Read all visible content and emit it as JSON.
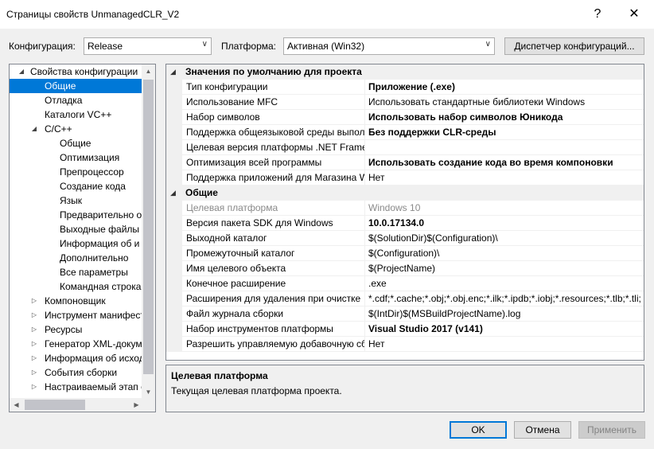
{
  "window": {
    "title": "Страницы свойств UnmanagedCLR_V2",
    "help_glyph": "?",
    "close_glyph": "✕"
  },
  "config_bar": {
    "configuration_label": "Конфигурация:",
    "configuration_value": "Release",
    "platform_label": "Платформа:",
    "platform_value": "Активная (Win32)",
    "manager_button": "Диспетчер конфигураций..."
  },
  "tree": {
    "items": [
      {
        "label": "Свойства конфигурации",
        "toggle": "◢",
        "selected": false
      },
      {
        "label": "Общие",
        "toggle": "",
        "selected": true
      },
      {
        "label": "Отладка",
        "toggle": "",
        "selected": false
      },
      {
        "label": "Каталоги VC++",
        "toggle": "",
        "selected": false
      },
      {
        "label": "C/C++",
        "toggle": "◢",
        "selected": false
      },
      {
        "label": "Общие",
        "toggle": "",
        "selected": false
      },
      {
        "label": "Оптимизация",
        "toggle": "",
        "selected": false
      },
      {
        "label": "Препроцессор",
        "toggle": "",
        "selected": false
      },
      {
        "label": "Создание кода",
        "toggle": "",
        "selected": false
      },
      {
        "label": "Язык",
        "toggle": "",
        "selected": false
      },
      {
        "label": "Предварительно о",
        "toggle": "",
        "selected": false
      },
      {
        "label": "Выходные файлы",
        "toggle": "",
        "selected": false
      },
      {
        "label": "Информация об и",
        "toggle": "",
        "selected": false
      },
      {
        "label": "Дополнительно",
        "toggle": "",
        "selected": false
      },
      {
        "label": "Все параметры",
        "toggle": "",
        "selected": false
      },
      {
        "label": "Командная строка",
        "toggle": "",
        "selected": false
      },
      {
        "label": "Компоновщик",
        "toggle": "▷",
        "selected": false
      },
      {
        "label": "Инструмент манифест",
        "toggle": "▷",
        "selected": false
      },
      {
        "label": "Ресурсы",
        "toggle": "▷",
        "selected": false
      },
      {
        "label": "Генератор XML-докум",
        "toggle": "▷",
        "selected": false
      },
      {
        "label": "Информация об исход",
        "toggle": "▷",
        "selected": false
      },
      {
        "label": "События сборки",
        "toggle": "▷",
        "selected": false
      },
      {
        "label": "Настраиваемый этап с",
        "toggle": "▷",
        "selected": false
      }
    ],
    "scroll_up_glyph": "▲",
    "scroll_down_glyph": "▼",
    "scroll_left_glyph": "◀",
    "scroll_right_glyph": "▶"
  },
  "grid": {
    "rows": [
      {
        "kind": "category",
        "name": "Значения по умолчанию для проекта",
        "toggle": "◢"
      },
      {
        "kind": "prop",
        "name": "Тип конфигурации",
        "value": "Приложение (.exe)",
        "style": "bold"
      },
      {
        "kind": "prop",
        "name": "Использование MFC",
        "value": "Использовать стандартные библиотеки Windows",
        "style": ""
      },
      {
        "kind": "prop",
        "name": "Набор символов",
        "value": "Использовать набор символов Юникода",
        "style": "bold"
      },
      {
        "kind": "prop",
        "name": "Поддержка общеязыковой среды выпол",
        "value": "Без поддержки CLR-среды",
        "style": "bold"
      },
      {
        "kind": "prop",
        "name": "Целевая версия платформы .NET Framew",
        "value": "",
        "style": ""
      },
      {
        "kind": "prop",
        "name": "Оптимизация всей программы",
        "value": "Использовать создание кода во время компоновки",
        "style": "bold"
      },
      {
        "kind": "prop",
        "name": "Поддержка приложений для Магазина W",
        "value": "Нет",
        "style": ""
      },
      {
        "kind": "category",
        "name": "Общие",
        "toggle": "◢"
      },
      {
        "kind": "prop",
        "name": "Целевая платформа",
        "value": "Windows 10",
        "style": "gray"
      },
      {
        "kind": "prop",
        "name": "Версия пакета SDK для Windows",
        "value": "10.0.17134.0",
        "style": "bold"
      },
      {
        "kind": "prop",
        "name": "Выходной каталог",
        "value": "$(SolutionDir)$(Configuration)\\",
        "style": ""
      },
      {
        "kind": "prop",
        "name": "Промежуточный каталог",
        "value": "$(Configuration)\\",
        "style": ""
      },
      {
        "kind": "prop",
        "name": "Имя целевого объекта",
        "value": "$(ProjectName)",
        "style": ""
      },
      {
        "kind": "prop",
        "name": "Конечное расширение",
        "value": ".exe",
        "style": ""
      },
      {
        "kind": "prop",
        "name": "Расширения для удаления при очистке",
        "value": "*.cdf;*.cache;*.obj;*.obj.enc;*.ilk;*.ipdb;*.iobj;*.resources;*.tlb;*.tli;",
        "style": ""
      },
      {
        "kind": "prop",
        "name": "Файл журнала сборки",
        "value": "$(IntDir)$(MSBuildProjectName).log",
        "style": ""
      },
      {
        "kind": "prop",
        "name": "Набор инструментов платформы",
        "value": "Visual Studio 2017 (v141)",
        "style": "bold"
      },
      {
        "kind": "prop",
        "name": "Разрешить управляемую добавочную сб",
        "value": "Нет",
        "style": ""
      }
    ]
  },
  "description": {
    "title": "Целевая платформа",
    "text": "Текущая целевая платформа проекта."
  },
  "buttons": {
    "ok": "OK",
    "cancel": "Отмена",
    "apply": "Применить"
  },
  "colors": {
    "selection": "#0078d7",
    "window_bg": "#f0f0f0"
  }
}
